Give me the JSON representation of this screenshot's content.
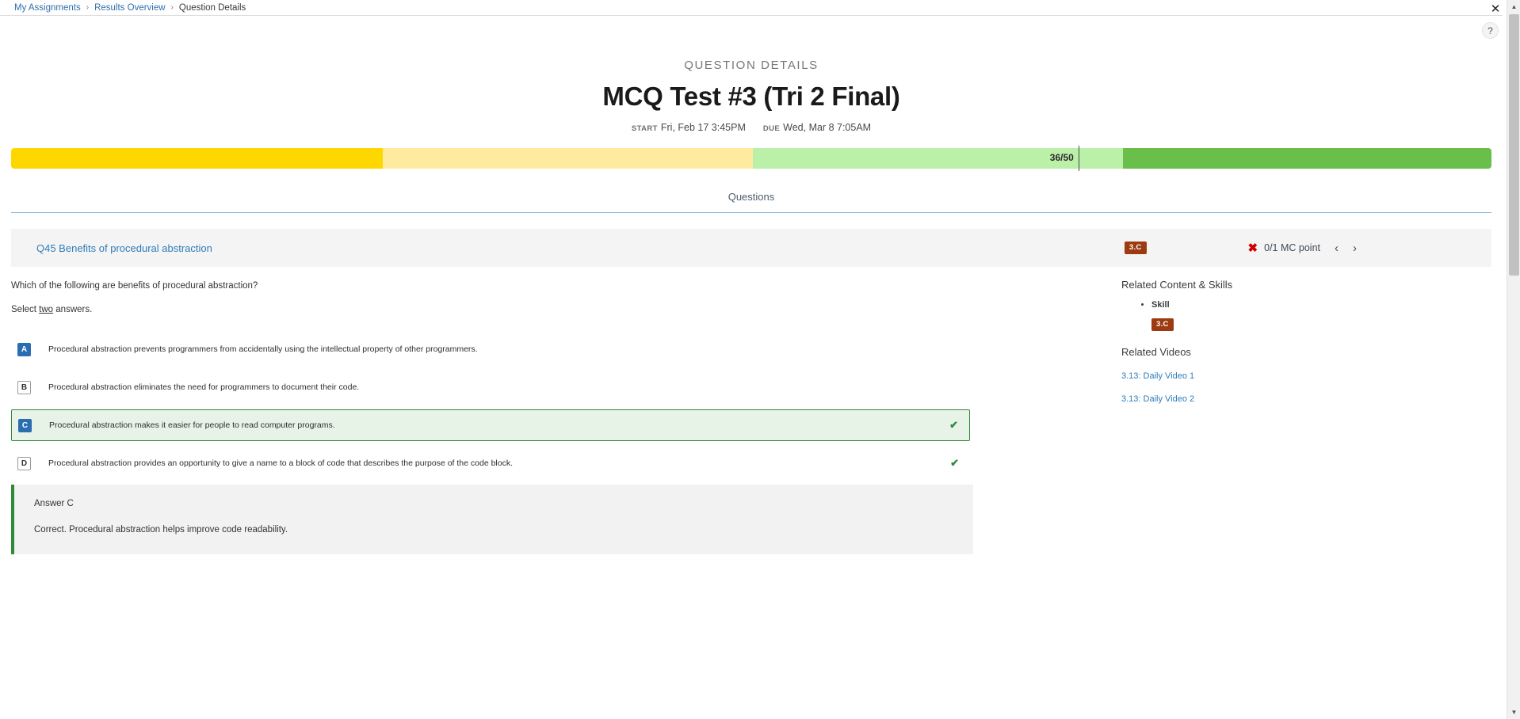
{
  "breadcrumb": {
    "items": [
      "My Assignments",
      "Results Overview",
      "Question Details"
    ],
    "separator": "›"
  },
  "window": {
    "close_icon": "✕",
    "help_label": "?",
    "scroll_up_icon": "▲",
    "scroll_down_icon": "▼"
  },
  "header": {
    "eyebrow": "QUESTION DETAILS",
    "title": "MCQ Test #3 (Tri 2 Final)",
    "start_label": "START",
    "start_value": "Fri, Feb 17 3:45PM",
    "due_label": "DUE",
    "due_value": "Wed, Mar 8 7:05AM"
  },
  "progress": {
    "score_label": "36/50",
    "marker_percent": 72.1,
    "segments": [
      {
        "color": "#ffd700",
        "width_percent": 25.1
      },
      {
        "color": "#ffeba0",
        "width_percent": 25.0
      },
      {
        "color": "#bbf0a8",
        "width_percent": 25.0
      },
      {
        "color": "#6abf4b",
        "width_percent": 24.9
      }
    ]
  },
  "tabs": [
    {
      "label": "Questions",
      "active": true
    }
  ],
  "question_header": {
    "title": "Q45 Benefits of procedural abstraction",
    "skill_badge": "3.C",
    "result_icon": "✖",
    "points": "0/1 MC point",
    "prev_icon": "‹",
    "next_icon": "›"
  },
  "question": {
    "prompt": "Which of the following are benefits of procedural abstraction?",
    "instruction_prefix": "Select ",
    "instruction_underlined": "two",
    "instruction_suffix": " answers.",
    "choices": [
      {
        "letter": "A",
        "text": "Procedural abstraction prevents programmers from accidentally using the intellectual property of other programmers.",
        "selected": true,
        "correct": false,
        "check_icon": ""
      },
      {
        "letter": "B",
        "text": "Procedural abstraction eliminates the need for programmers to document their code.",
        "selected": false,
        "correct": false,
        "check_icon": ""
      },
      {
        "letter": "C",
        "text": "Procedural abstraction makes it easier for people to read computer programs.",
        "selected": true,
        "correct": true,
        "check_icon": "✔"
      },
      {
        "letter": "D",
        "text": "Procedural abstraction provides an opportunity to give a name to a block of code that describes the purpose of the code block.",
        "selected": false,
        "correct": true,
        "check_icon": "✔"
      }
    ]
  },
  "answer_box": {
    "heading": "Answer C",
    "text": "Correct. Procedural abstraction helps improve code readability."
  },
  "sidebar": {
    "related_skills_heading": "Related Content & Skills",
    "skill_item": "Skill",
    "skill_badge": "3.C",
    "related_videos_heading": "Related Videos",
    "videos": [
      "3.13: Daily Video 1",
      "3.13: Daily Video 2"
    ]
  },
  "colors": {
    "link_blue": "#2f7cb8",
    "badge_red": "#9c3a11",
    "correct_green": "#2e8b3a",
    "wrong_red": "#cc0000"
  }
}
